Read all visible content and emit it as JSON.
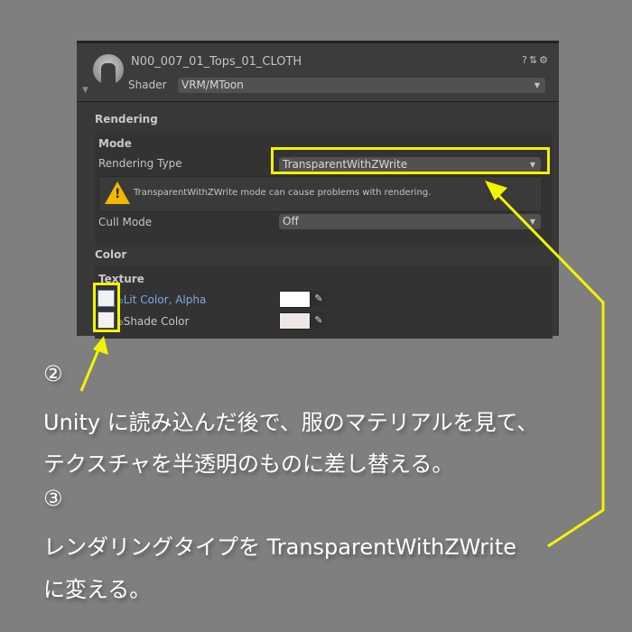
{
  "inspector": {
    "material_name": "N00_007_01_Tops_01_CLOTH",
    "header_icons": [
      "help-icon",
      "preset-icon",
      "gear-icon"
    ],
    "shader_label": "Shader",
    "shader_value": "VRM/MToon",
    "rendering_section": "Rendering",
    "mode_group": "Mode",
    "rendering_type_label": "Rendering Type",
    "rendering_type_value": "TransparentWithZWrite",
    "warning": "TransparentWithZWrite mode can cause problems with rendering.",
    "cull_mode_label": "Cull Mode",
    "cull_mode_value": "Off",
    "color_section": "Color",
    "texture_group": "Texture",
    "lit_color_label": "Lit Color, Alpha",
    "shade_color_label": "Shade Color",
    "lit_color_hex": "#ffffff",
    "shade_color_hex": "#efe6e6"
  },
  "annotations": {
    "step2": "②",
    "step2_line1": "Unity に読み込んだ後で、服のマテリアルを見て、",
    "step2_line2": "テクスチャを半透明のものに差し替える。",
    "step3": "③",
    "step3_line1": "レンダリングタイプを TransparentWithZWrite",
    "step3_line2": "に変える。",
    "highlight_color": "#f3f300"
  }
}
